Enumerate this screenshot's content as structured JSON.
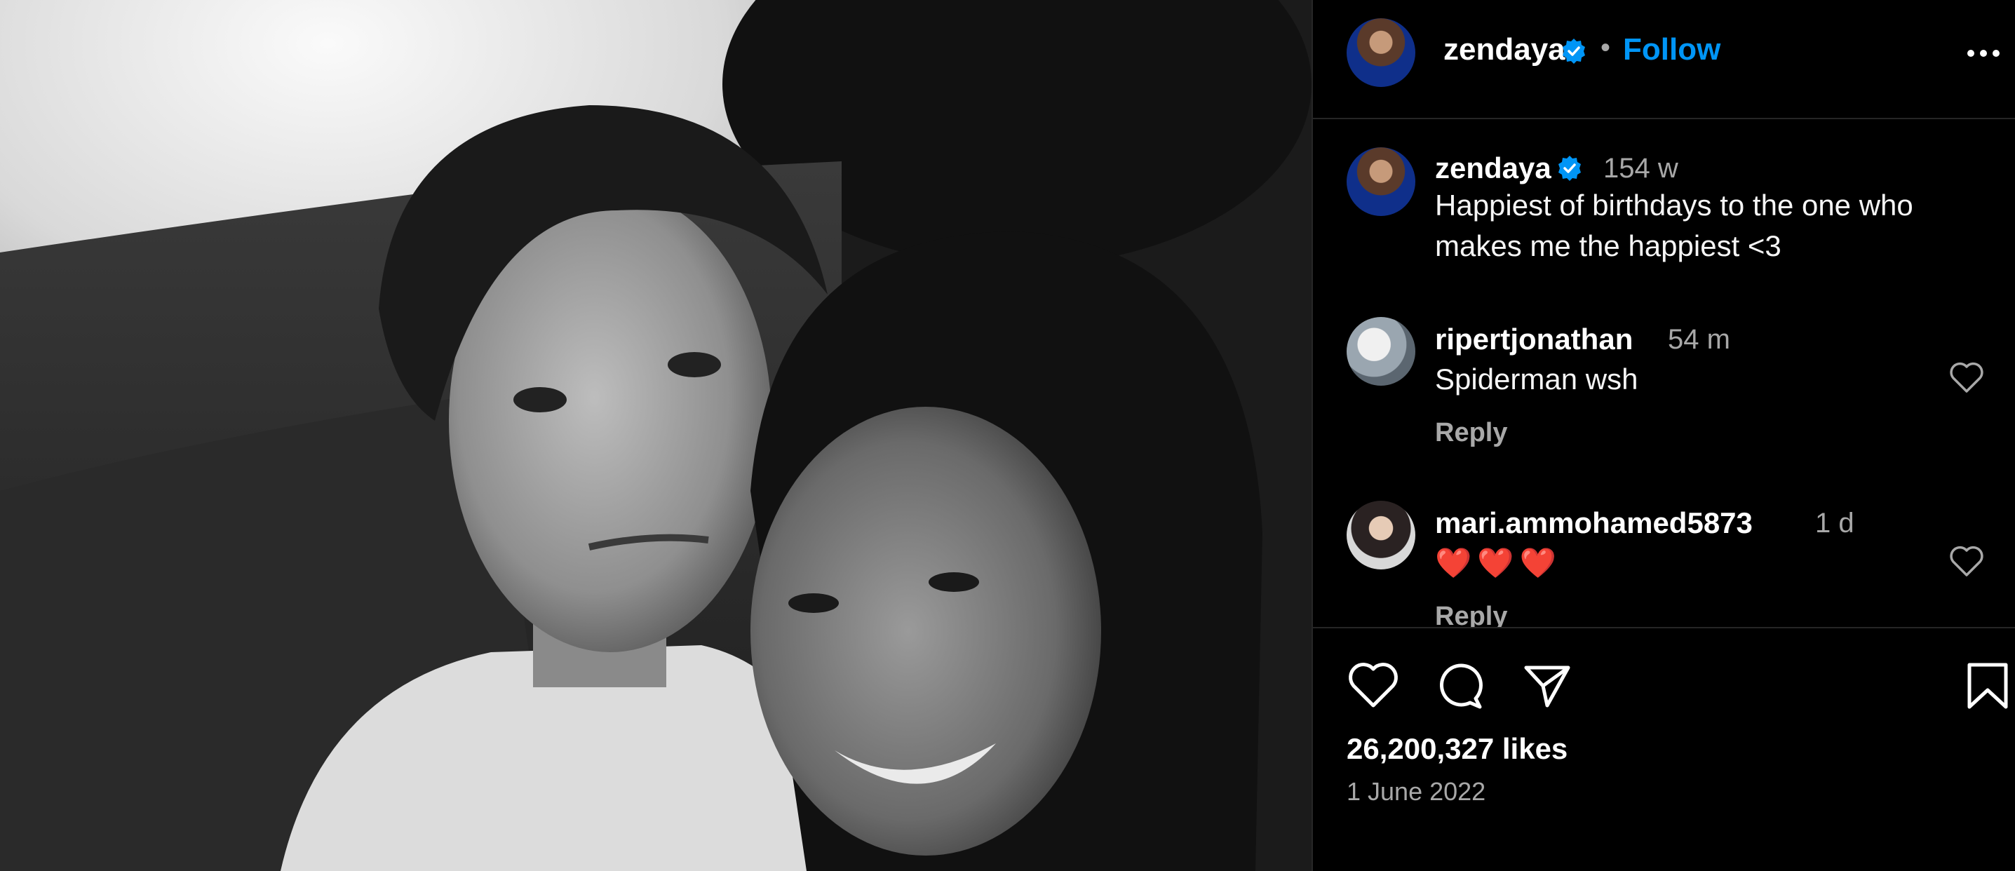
{
  "post": {
    "username": "zendaya",
    "follow_label": "Follow",
    "separator": "•",
    "caption_time": "154 w",
    "caption": "Happiest of birthdays to the one who makes me the happiest <3",
    "likes": "26,200,327 likes",
    "date": "1 June 2022"
  },
  "comments": [
    {
      "username": "ripertjonathan",
      "time": "54 m",
      "text": "Spiderman wsh",
      "reply_label": "Reply"
    },
    {
      "username": "mari.ammohamed5873",
      "time": "1 d",
      "text": "❤️❤️❤️",
      "reply_label": "Reply"
    }
  ],
  "colors": {
    "accent": "#0095f6",
    "verified": "#0095f6",
    "muted": "#a8a8a8",
    "divider": "#262626",
    "heart_red": "#ed1c3a"
  },
  "icons": [
    "verified-badge-icon",
    "more-options-icon",
    "heart-icon",
    "comment-icon",
    "share-icon",
    "bookmark-icon"
  ]
}
